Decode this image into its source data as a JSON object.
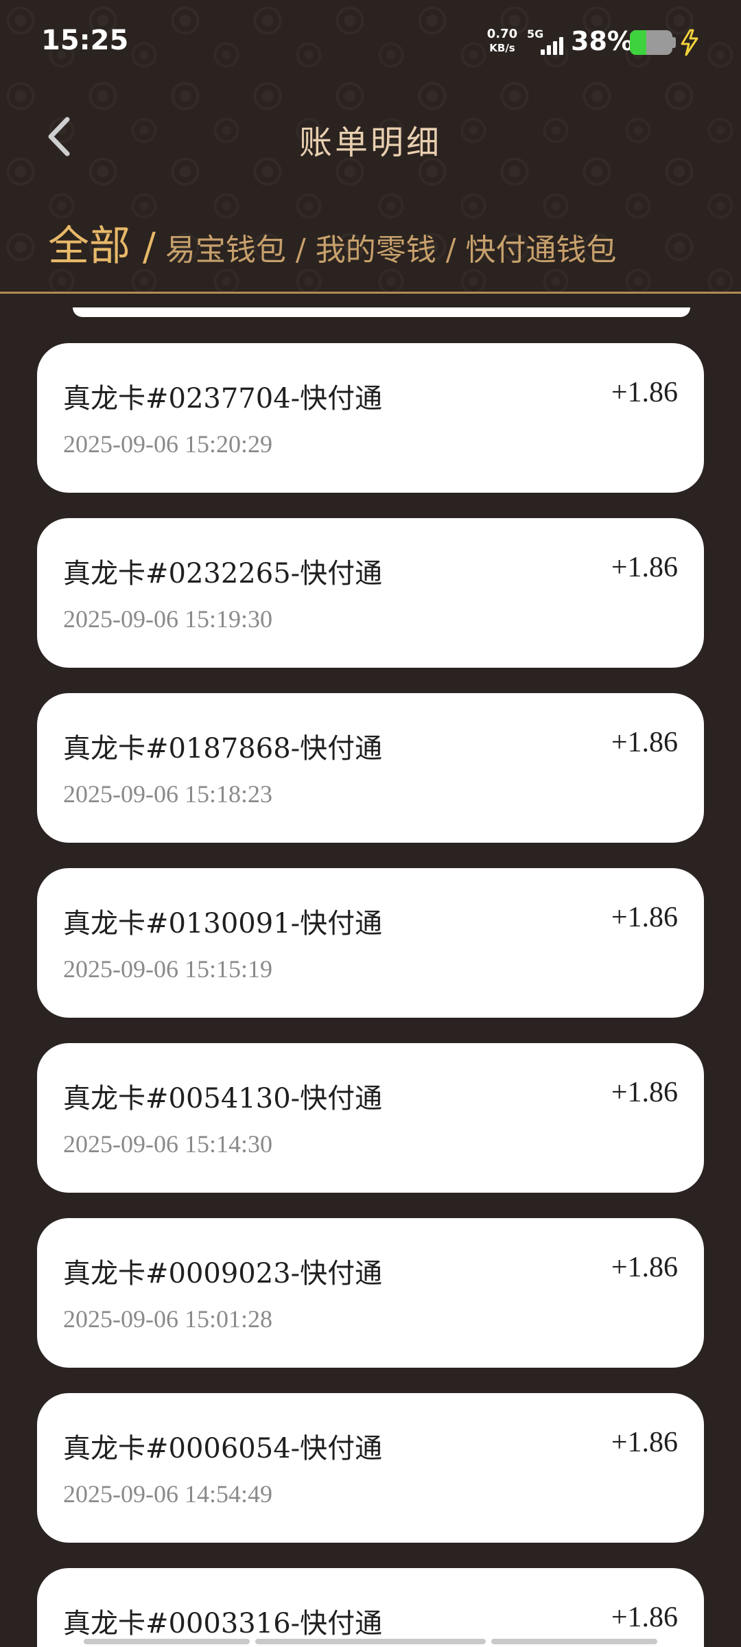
{
  "status_bar": {
    "time": "15:25",
    "net_speed_value": "0.70",
    "net_speed_unit": "KB/s",
    "net_type": "5G",
    "battery_percent": "38%",
    "battery_level": 0.38
  },
  "header": {
    "title": "账单明细",
    "tabs": [
      {
        "label": "全部",
        "active": true
      },
      {
        "label": "易宝钱包",
        "active": false
      },
      {
        "label": "我的零钱",
        "active": false
      },
      {
        "label": "快付通钱包",
        "active": false
      }
    ],
    "separator": "/"
  },
  "transactions": [
    {
      "title": "真龙卡#0237704-快付通",
      "time": "2025-09-06 15:20:29",
      "amount": "+1.86"
    },
    {
      "title": "真龙卡#0232265-快付通",
      "time": "2025-09-06 15:19:30",
      "amount": "+1.86"
    },
    {
      "title": "真龙卡#0187868-快付通",
      "time": "2025-09-06 15:18:23",
      "amount": "+1.86"
    },
    {
      "title": "真龙卡#0130091-快付通",
      "time": "2025-09-06 15:15:19",
      "amount": "+1.86"
    },
    {
      "title": "真龙卡#0054130-快付通",
      "time": "2025-09-06 15:14:30",
      "amount": "+1.86"
    },
    {
      "title": "真龙卡#0009023-快付通",
      "time": "2025-09-06 15:01:28",
      "amount": "+1.86"
    },
    {
      "title": "真龙卡#0006054-快付通",
      "time": "2025-09-06 14:54:49",
      "amount": "+1.86"
    },
    {
      "title": "真龙卡#0003316-快付通",
      "time": "",
      "amount": "+1.86"
    }
  ],
  "colors": {
    "background": "#2a2321",
    "accent_gold": "#e8b96a",
    "tab_gold": "#c7a06c",
    "title_text": "#e8cfb0",
    "card": "#ffffff"
  }
}
